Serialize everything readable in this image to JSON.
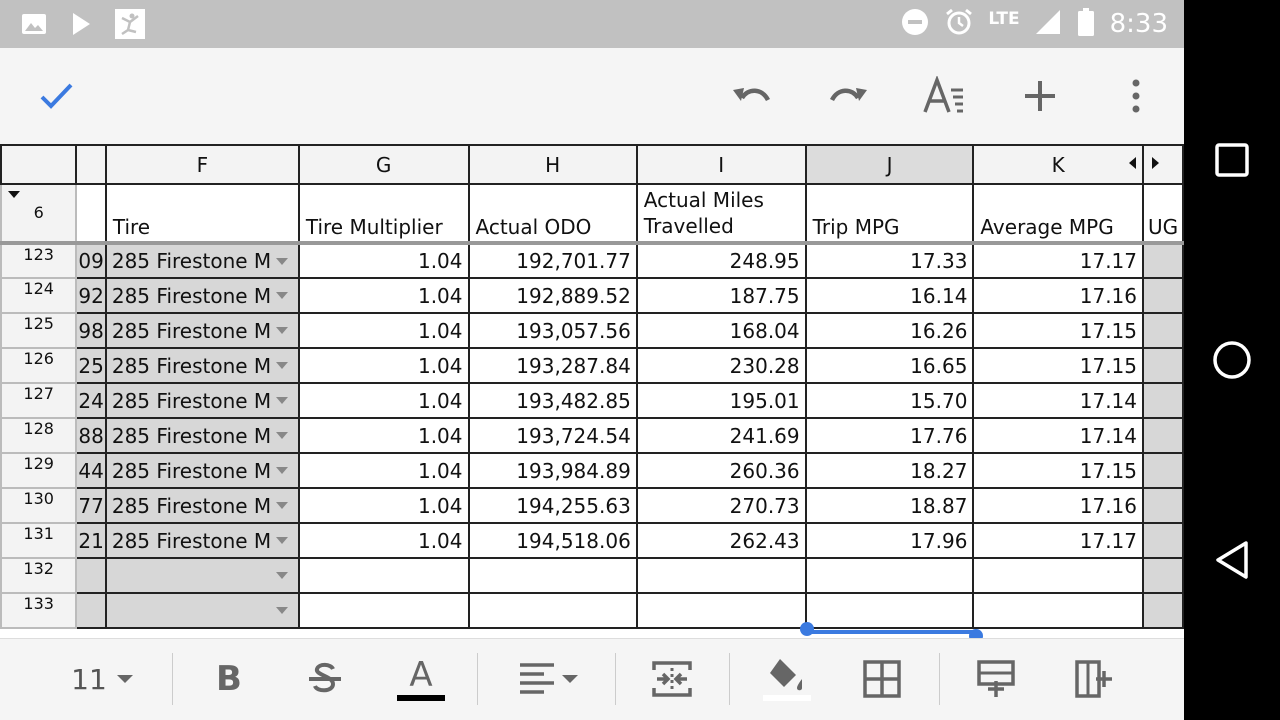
{
  "status_bar": {
    "time": "8:33",
    "network": "LTE",
    "icons": [
      "image-icon",
      "play-store-icon",
      "fitness-app-icon",
      "do-not-disturb-icon",
      "alarm-icon",
      "signal-icon",
      "battery-icon"
    ]
  },
  "toolbar": {
    "icons": [
      "check-icon",
      "undo-icon",
      "redo-icon",
      "text-format-icon",
      "add-icon",
      "more-vert-icon"
    ],
    "accent": "#3b7ae0"
  },
  "sheet": {
    "columns": [
      "F",
      "G",
      "H",
      "I",
      "J",
      "K"
    ],
    "selected_column": "J",
    "header_row_number": "6",
    "headers": {
      "partial": "",
      "tire": "Tire",
      "tire_multiplier": "Tire Multiplier",
      "actual_odo": "Actual ODO",
      "actual_miles": "Actual Miles Travelled",
      "trip_mpg": "Trip MPG",
      "average_mpg": "Average MPG",
      "partial_next": "UG"
    },
    "rows": [
      {
        "num": "123",
        "partial": "09",
        "tire": "285 Firestone M",
        "mult": "1.04",
        "odo": "192,701.77",
        "miles": "248.95",
        "trip": "17.33",
        "avg": "17.17"
      },
      {
        "num": "124",
        "partial": "92",
        "tire": "285 Firestone M",
        "mult": "1.04",
        "odo": "192,889.52",
        "miles": "187.75",
        "trip": "16.14",
        "avg": "17.16"
      },
      {
        "num": "125",
        "partial": "98",
        "tire": "285 Firestone M",
        "mult": "1.04",
        "odo": "193,057.56",
        "miles": "168.04",
        "trip": "16.26",
        "avg": "17.15"
      },
      {
        "num": "126",
        "partial": "25",
        "tire": "285 Firestone M",
        "mult": "1.04",
        "odo": "193,287.84",
        "miles": "230.28",
        "trip": "16.65",
        "avg": "17.15"
      },
      {
        "num": "127",
        "partial": "24",
        "tire": "285 Firestone M",
        "mult": "1.04",
        "odo": "193,482.85",
        "miles": "195.01",
        "trip": "15.70",
        "avg": "17.14"
      },
      {
        "num": "128",
        "partial": "88",
        "tire": "285 Firestone M",
        "mult": "1.04",
        "odo": "193,724.54",
        "miles": "241.69",
        "trip": "17.76",
        "avg": "17.14"
      },
      {
        "num": "129",
        "partial": "44",
        "tire": "285 Firestone M",
        "mult": "1.04",
        "odo": "193,984.89",
        "miles": "260.36",
        "trip": "18.27",
        "avg": "17.15"
      },
      {
        "num": "130",
        "partial": "77",
        "tire": "285 Firestone M",
        "mult": "1.04",
        "odo": "194,255.63",
        "miles": "270.73",
        "trip": "18.87",
        "avg": "17.16"
      },
      {
        "num": "131",
        "partial": "21",
        "tire": "285 Firestone M",
        "mult": "1.04",
        "odo": "194,518.06",
        "miles": "262.43",
        "trip": "17.96",
        "avg": "17.17"
      },
      {
        "num": "132",
        "partial": "",
        "tire": "",
        "mult": "",
        "odo": "",
        "miles": "",
        "trip": "",
        "avg": ""
      },
      {
        "num": "133",
        "partial": "",
        "tire": "",
        "mult": "",
        "odo": "",
        "miles": "",
        "trip": "",
        "avg": ""
      }
    ]
  },
  "format_bar": {
    "font_size": "11",
    "bold_label": "B",
    "text_color_label": "A",
    "icons": [
      "font-size-dropdown-icon",
      "bold-icon",
      "strikethrough-icon",
      "text-color-icon",
      "align-icon",
      "merge-cells-icon",
      "fill-color-icon",
      "borders-icon",
      "insert-row-icon",
      "insert-column-icon"
    ]
  }
}
